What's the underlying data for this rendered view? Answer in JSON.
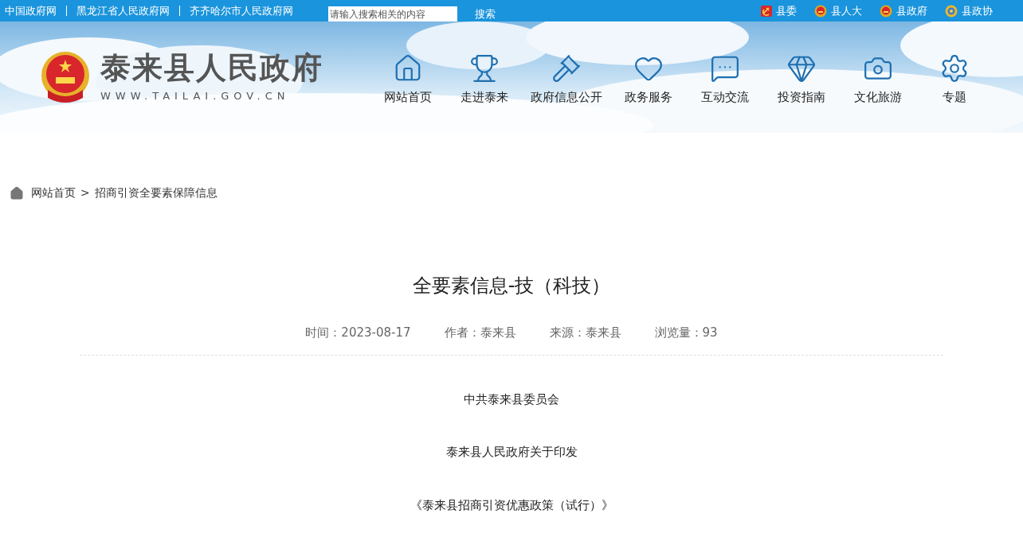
{
  "top_bar": {
    "links": [
      "中国政府网",
      "黑龙江省人民政府网",
      "齐齐哈尔市人民政府网"
    ],
    "search": {
      "placeholder": "请输入搜索相关的内容",
      "button": "搜索"
    },
    "portals": [
      {
        "label": "县委",
        "kind": "party"
      },
      {
        "label": "县人大",
        "kind": "emblem"
      },
      {
        "label": "县政府",
        "kind": "emblem"
      },
      {
        "label": "县政协",
        "kind": "cppcc"
      }
    ]
  },
  "header": {
    "site_name": "泰来县人民政府",
    "domain": "WWW.TAILAI.GOV.CN",
    "nav": [
      {
        "label": "网站首页",
        "kind": "home"
      },
      {
        "label": "走进泰来",
        "kind": "trophy"
      },
      {
        "label": "政府信息公开",
        "kind": "gavel"
      },
      {
        "label": "政务服务",
        "kind": "heart"
      },
      {
        "label": "互动交流",
        "kind": "chat"
      },
      {
        "label": "投资指南",
        "kind": "gem"
      },
      {
        "label": "文化旅游",
        "kind": "camera"
      },
      {
        "label": "专题",
        "kind": "gear"
      }
    ]
  },
  "breadcrumb": {
    "items": [
      "网站首页",
      "招商引资全要素保障信息"
    ],
    "separator": ">"
  },
  "article": {
    "title": "全要素信息-技（科技）",
    "meta": [
      "时间：2023-08-17",
      "作者：泰来县",
      "来源：泰来县",
      "浏览量：93"
    ],
    "paragraphs": [
      "中共泰来县委员会",
      "泰来县人民政府关于印发",
      "《泰来县招商引资优惠政策（试行）》"
    ]
  }
}
